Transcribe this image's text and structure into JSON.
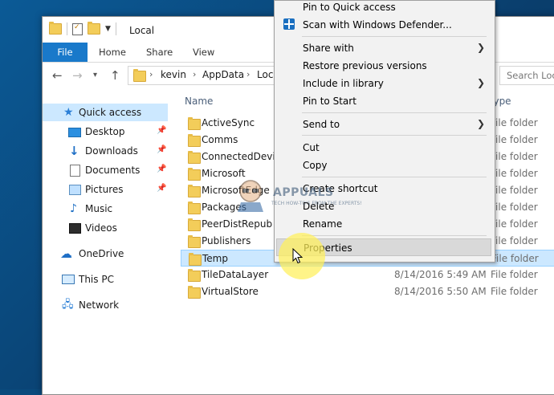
{
  "window": {
    "title": "Local"
  },
  "ribbon": {
    "tabs": [
      "File",
      "Home",
      "Share",
      "View"
    ]
  },
  "address": {
    "crumbs": [
      "kevin",
      "AppData",
      "Local"
    ],
    "search_placeholder": "Search Local"
  },
  "nav": {
    "quick_access": "Quick access",
    "items": [
      "Desktop",
      "Downloads",
      "Documents",
      "Pictures",
      "Music",
      "Videos"
    ],
    "onedrive": "OneDrive",
    "thispc": "This PC",
    "network": "Network"
  },
  "columns": {
    "name": "Name",
    "type": "Type"
  },
  "files": [
    {
      "name": "ActiveSync",
      "date": "",
      "type": "File folder"
    },
    {
      "name": "Comms",
      "date": "",
      "type": "File folder"
    },
    {
      "name": "ConnectedDevicesPlatform",
      "date": "",
      "type": "File folder"
    },
    {
      "name": "Microsoft",
      "date": "",
      "type": "File folder"
    },
    {
      "name": "MicrosoftEdge",
      "date": "",
      "type": "File folder"
    },
    {
      "name": "Packages",
      "date": "",
      "type": "File folder"
    },
    {
      "name": "PeerDistRepub",
      "date": "",
      "type": "File folder"
    },
    {
      "name": "Publishers",
      "date": "",
      "type": "File folder"
    },
    {
      "name": "Temp",
      "date": "",
      "type": "File folder"
    },
    {
      "name": "TileDataLayer",
      "date": "8/14/2016 5:49 AM",
      "type": "File folder"
    },
    {
      "name": "VirtualStore",
      "date": "8/14/2016 5:50 AM",
      "type": "File folder"
    }
  ],
  "context_menu": {
    "items": [
      "Pin to Quick access",
      "Scan with Windows Defender...",
      "Share with",
      "Restore previous versions",
      "Include in library",
      "Pin to Start",
      "Send to",
      "Cut",
      "Copy",
      "Create shortcut",
      "Delete",
      "Rename",
      "Properties"
    ]
  },
  "watermark": {
    "brand": "APPUALS",
    "tagline": "TECH HOW-TO'S FROM THE EXPERTS!"
  },
  "colors": {
    "accent": "#1979ca",
    "selection": "#cce8ff",
    "folder": "#f3cd5a"
  }
}
